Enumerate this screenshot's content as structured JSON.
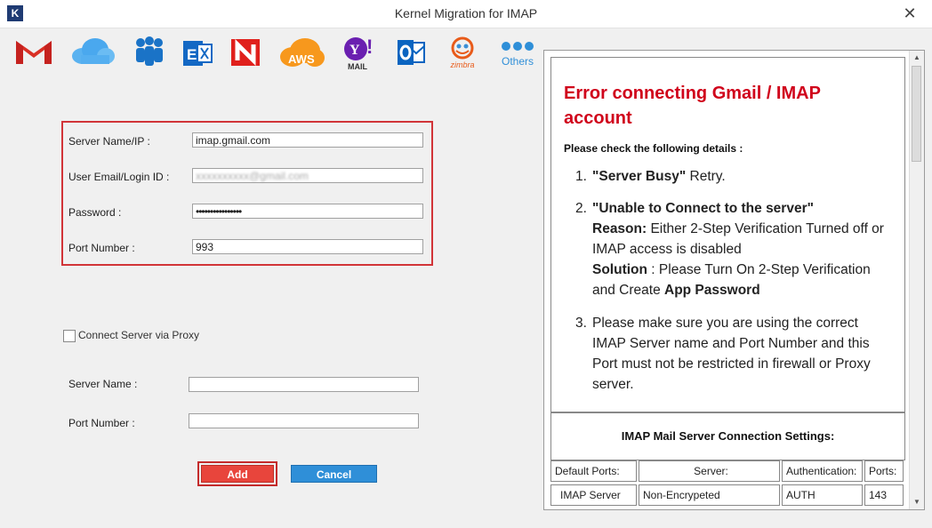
{
  "window": {
    "title": "Kernel Migration for IMAP",
    "app_icon_letter": "K",
    "close_glyph": "✕"
  },
  "logos": [
    {
      "name": "gmail",
      "caption": ""
    },
    {
      "name": "icloud",
      "caption": ""
    },
    {
      "name": "sharepoint",
      "caption": ""
    },
    {
      "name": "exchange",
      "caption": ""
    },
    {
      "name": "notes",
      "caption": ""
    },
    {
      "name": "aws",
      "caption": "AWS"
    },
    {
      "name": "yahoo",
      "caption": "MAIL"
    },
    {
      "name": "outlook",
      "caption": ""
    },
    {
      "name": "zimbra",
      "caption": "zimbra"
    },
    {
      "name": "others",
      "caption": "Others"
    }
  ],
  "form": {
    "server_label": "Server Name/IP :",
    "server_value": "imap.gmail.com",
    "email_label": "User Email/Login ID :",
    "email_value": "xxxxxxxxxx@gmail.com",
    "password_label": "Password :",
    "password_value": "••••••••••••••••",
    "port_label": "Port Number :",
    "port_value": "993"
  },
  "proxy": {
    "checkbox_label": "Connect Server via Proxy",
    "server_label": "Server Name :",
    "port_label": "Port Number :",
    "server_value": "",
    "port_value": ""
  },
  "buttons": {
    "add": "Add",
    "cancel": "Cancel"
  },
  "help": {
    "title": "Error connecting Gmail / IMAP account",
    "check_heading": "Please check the following details :",
    "item1_num": "1.",
    "item1_quote_open": "\"",
    "item1_bold": "Server Busy",
    "item1_quote_close": "\"",
    "item1_text": " Retry.",
    "item2_num": "2.",
    "item2_bold": "\"Unable to Connect to the server\"",
    "item2_reason_label": "Reason:",
    "item2_reason": " Either 2-Step Verification Turned off or IMAP access is disabled",
    "item2_solution_label": "Solution",
    "item2_solution": " : Please Turn On 2-Step Verification and Create ",
    "item2_app_password": "App Password",
    "item3_num": "3.",
    "item3_text": "Please make sure you are using the correct IMAP Server name and Port Number and this Port must not be restricted in firewall or Proxy server.",
    "settings_title": "IMAP Mail Server Connection Settings:",
    "table_headers": [
      "Default Ports:",
      "Server:",
      "Authentication:",
      "Ports:"
    ],
    "table_row": [
      "IMAP Server",
      "Non-Encrypeted",
      "AUTH",
      "143"
    ]
  },
  "colors": {
    "accent_red": "#d0021b",
    "add_button": "#e8453c",
    "cancel_button": "#2f8fd8"
  }
}
